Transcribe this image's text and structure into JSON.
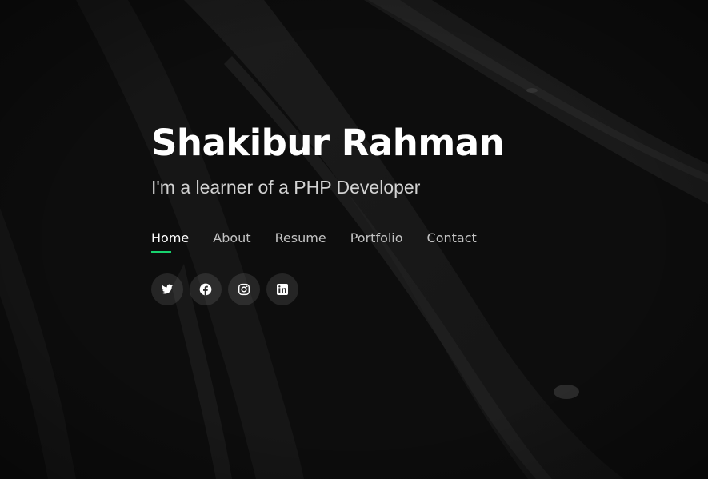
{
  "hero": {
    "name": "Shakibur Rahman",
    "tagline": "I'm a learner of a PHP Developer"
  },
  "nav": {
    "items": [
      {
        "label": "Home",
        "active": true
      },
      {
        "label": "About",
        "active": false
      },
      {
        "label": "Resume",
        "active": false
      },
      {
        "label": "Portfolio",
        "active": false
      },
      {
        "label": "Contact",
        "active": false
      }
    ]
  },
  "socials": [
    {
      "icon": "twitter-icon"
    },
    {
      "icon": "facebook-icon"
    },
    {
      "icon": "instagram-icon"
    },
    {
      "icon": "linkedin-icon"
    }
  ],
  "colors": {
    "accent": "#18d26e",
    "background": "#0d0d0d",
    "text": "#ffffff",
    "muted_text": "#c2c2c2"
  }
}
